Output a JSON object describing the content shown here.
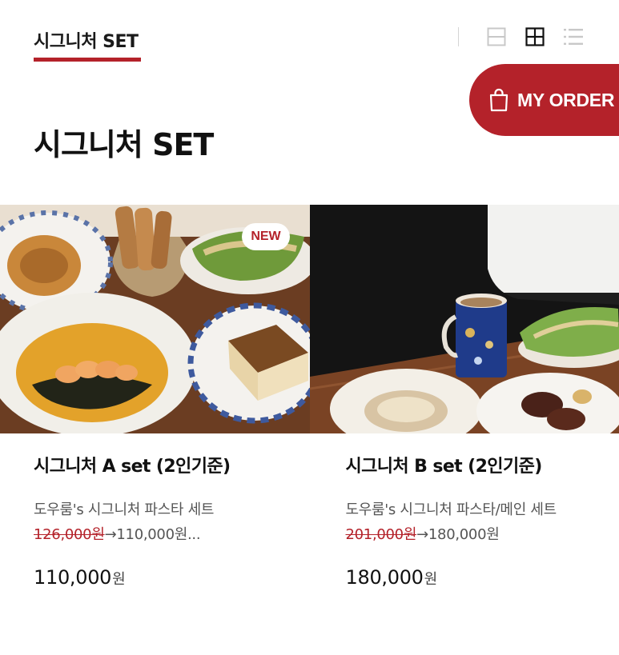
{
  "header": {
    "active_tab": "시그니처 SET",
    "view_modes": [
      {
        "name": "single-view",
        "icon": "single-column-icon",
        "active": false
      },
      {
        "name": "grid-view",
        "icon": "grid-icon",
        "active": true
      },
      {
        "name": "list-view",
        "icon": "list-icon",
        "active": false
      }
    ]
  },
  "my_order": {
    "label": "MY ORDER",
    "icon": "shopping-bag-icon"
  },
  "page": {
    "title": "시그니처 SET"
  },
  "products": [
    {
      "name": "시그니처 A set (2인기준)",
      "badge": "NEW",
      "desc_prefix": "도우룸's 시그니처 파스타 세트",
      "old_price": "126,000원",
      "arrow_text": "→110,000원...",
      "price": "110,000",
      "price_unit": "원"
    },
    {
      "name": "시그니처 B set (2인기준)",
      "badge": "",
      "desc_prefix": "도우룸's 시그니처 파스타/메인 세트",
      "old_price": "201,000원",
      "arrow_text": "→180,000원",
      "price": "180,000",
      "price_unit": "원"
    }
  ],
  "colors": {
    "accent": "#b4222a",
    "text": "#1a1a1a",
    "muted": "#555555"
  }
}
